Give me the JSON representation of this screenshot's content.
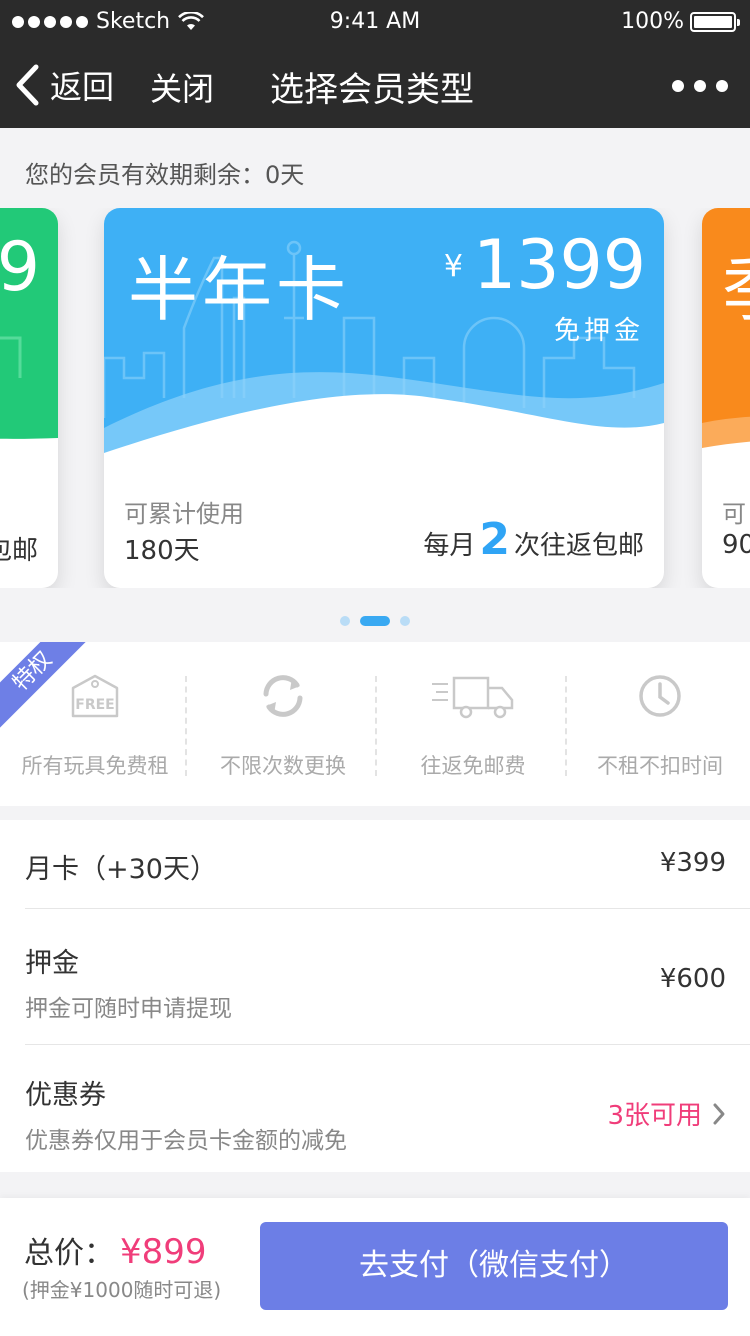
{
  "status_bar": {
    "carrier": "Sketch",
    "time": "9:41 AM",
    "battery": "100%"
  },
  "nav": {
    "back": "返回",
    "close": "关闭",
    "title": "选择会员类型"
  },
  "remaining": "您的会员有效期剩余：0天",
  "cards": {
    "left": {
      "price_partial": "9",
      "ship_partial": "包邮"
    },
    "main": {
      "name": "半年卡",
      "currency": "¥",
      "price": "1399",
      "deposit": "免押金",
      "usage_label": "可累计使用",
      "days": "180天",
      "ship_prefix": "每月",
      "ship_count": "2",
      "ship_suffix": "次往返包邮"
    },
    "right": {
      "name_partial": "季",
      "label_partial": "可",
      "days_partial": "90"
    }
  },
  "pager": {
    "count": 3,
    "active": 1
  },
  "privileges": {
    "ribbon": "特权",
    "items": [
      {
        "icon": "free-tag-icon",
        "label": "所有玩具免费租"
      },
      {
        "icon": "refresh-icon",
        "label": "不限次数更换"
      },
      {
        "icon": "truck-icon",
        "label": "往返免邮费"
      },
      {
        "icon": "clock-icon",
        "label": "不租不扣时间"
      }
    ]
  },
  "orders": {
    "card": {
      "title": "月卡（+30天）",
      "value": "¥399"
    },
    "deposit": {
      "title": "押金",
      "subtitle": "押金可随时申请提现",
      "value": "¥600"
    },
    "coupon": {
      "title": "优惠券",
      "subtitle": "优惠券仅用于会员卡金额的减免",
      "value": "3张可用"
    }
  },
  "footer": {
    "total_label": "总价：",
    "total": "¥899",
    "note": "(押金¥1000随时可退)",
    "pay": "去支付（微信支付）"
  },
  "colors": {
    "primary": "#6c7ee6",
    "card_blue": "#3eb0f5",
    "card_green": "#22c978",
    "card_orange": "#f98a1c",
    "accent_pink": "#f03d7a"
  }
}
